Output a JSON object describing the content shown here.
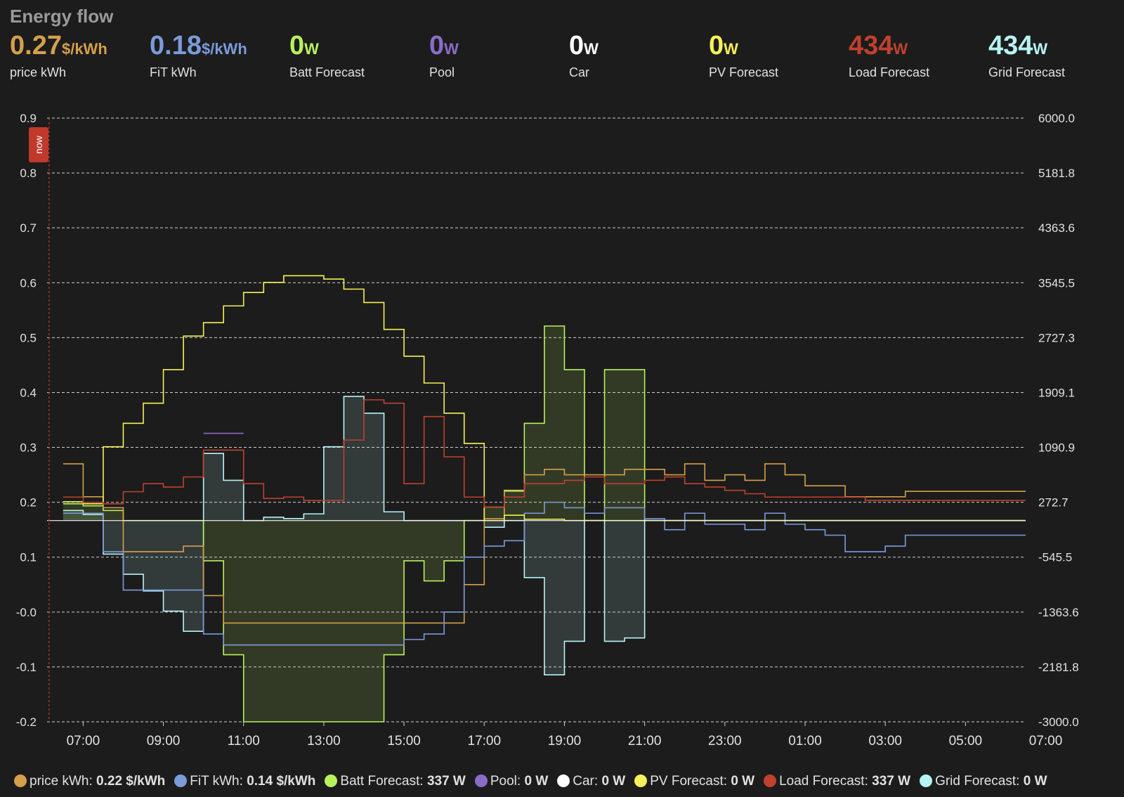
{
  "header": {
    "title": "Energy flow"
  },
  "stats": [
    {
      "value": "0.27",
      "unit": "$/kWh",
      "label": "price kWh",
      "color": "#d4a04a"
    },
    {
      "value": "0.18",
      "unit": "$/kWh",
      "label": "FiT kWh",
      "color": "#7b9bd9"
    },
    {
      "value": "0",
      "unit": "W",
      "label": "Batt Forecast",
      "color": "#b7f25c"
    },
    {
      "value": "0",
      "unit": "W",
      "label": "Pool",
      "color": "#8a6cc8"
    },
    {
      "value": "0",
      "unit": "W",
      "label": "Car",
      "color": "#ffffff"
    },
    {
      "value": "0",
      "unit": "W",
      "label": "PV Forecast",
      "color": "#f5f05a"
    },
    {
      "value": "434",
      "unit": "W",
      "label": "Load Forecast",
      "color": "#c0412e"
    },
    {
      "value": "434",
      "unit": "W",
      "label": "Grid Forecast",
      "color": "#b8f2f4"
    }
  ],
  "now_label": "now",
  "legend": [
    {
      "name": "price kWh",
      "value": "0.22 $/kWh",
      "color": "#d4a04a"
    },
    {
      "name": "FiT kWh",
      "value": "0.14 $/kWh",
      "color": "#7b9bd9"
    },
    {
      "name": "Batt Forecast",
      "value": "337 W",
      "color": "#b7f25c"
    },
    {
      "name": "Pool",
      "value": "0 W",
      "color": "#8a6cc8"
    },
    {
      "name": "Car",
      "value": "0 W",
      "color": "#ffffff"
    },
    {
      "name": "PV Forecast",
      "value": "0 W",
      "color": "#f5f05a"
    },
    {
      "name": "Load Forecast",
      "value": "337 W",
      "color": "#c0412e"
    },
    {
      "name": "Grid Forecast",
      "value": "0 W",
      "color": "#b8f2f4"
    }
  ],
  "chart_data": {
    "type": "line",
    "step": true,
    "grid": true,
    "x_ticks": [
      "07:00",
      "09:00",
      "11:00",
      "13:00",
      "15:00",
      "17:00",
      "19:00",
      "21:00",
      "23:00",
      "01:00",
      "03:00",
      "05:00",
      "07:00"
    ],
    "x_range_hours": [
      6.1,
      30.5
    ],
    "y_left": {
      "range": [
        -0.2,
        0.9
      ],
      "ticks": [
        "0.9",
        "0.8",
        "0.7",
        "0.6",
        "0.5",
        "0.4",
        "0.3",
        "0.2",
        "0.1",
        "-0.0",
        "-0.1",
        "-0.2"
      ]
    },
    "y_right": {
      "range": [
        -3000,
        6000
      ],
      "ticks": [
        "6000.0",
        "5181.8",
        "4363.6",
        "3545.5",
        "2727.3",
        "1909.1",
        "1090.9",
        "272.7",
        "-545.5",
        "-1363.6",
        "-2181.8",
        "-3000.0"
      ]
    },
    "now_hour": 6.15,
    "series": [
      {
        "name": "price kWh",
        "axis": "left",
        "color": "#d4a04a",
        "fill": false,
        "x": [
          6.5,
          7.0,
          7.5,
          8.0,
          8.5,
          9.0,
          9.5,
          10.0,
          10.5,
          11.0,
          11.5,
          12.0,
          12.5,
          13.0,
          13.5,
          14.0,
          14.5,
          15.0,
          15.5,
          16.0,
          16.5,
          17.0,
          17.5,
          18.0,
          18.5,
          19.0,
          19.5,
          20.0,
          20.5,
          21.0,
          21.5,
          22.0,
          22.5,
          23.0,
          23.5,
          24.0,
          24.5,
          25.0,
          25.5,
          26.0,
          26.5,
          27.0,
          27.5,
          28.0,
          28.5,
          29.0,
          29.5,
          30.0,
          30.5
        ],
        "y": [
          0.27,
          0.21,
          0.19,
          0.11,
          0.11,
          0.11,
          0.12,
          0.03,
          -0.02,
          -0.02,
          -0.02,
          -0.02,
          -0.02,
          -0.02,
          -0.02,
          -0.02,
          -0.02,
          -0.02,
          -0.02,
          -0.02,
          0.05,
          0.17,
          0.22,
          0.25,
          0.26,
          0.25,
          0.25,
          0.25,
          0.26,
          0.26,
          0.25,
          0.27,
          0.24,
          0.25,
          0.24,
          0.27,
          0.25,
          0.23,
          0.23,
          0.21,
          0.21,
          0.21,
          0.22,
          0.22,
          0.22,
          0.22,
          0.22,
          0.22,
          0.22
        ]
      },
      {
        "name": "FiT kWh",
        "axis": "left",
        "color": "#7b9bd9",
        "fill": false,
        "x": [
          6.5,
          7.0,
          7.5,
          8.0,
          8.5,
          9.0,
          9.5,
          10.0,
          10.5,
          11.0,
          11.5,
          12.0,
          12.5,
          13.0,
          13.5,
          14.0,
          14.5,
          15.0,
          15.5,
          16.0,
          16.5,
          17.0,
          17.5,
          18.0,
          18.5,
          19.0,
          19.5,
          20.0,
          20.5,
          21.0,
          21.5,
          22.0,
          22.5,
          23.0,
          23.5,
          24.0,
          24.5,
          25.0,
          25.5,
          26.0,
          26.5,
          27.0,
          27.5,
          28.0,
          28.5,
          29.0,
          29.5,
          30.0,
          30.5
        ],
        "y": [
          0.18,
          0.18,
          0.11,
          0.04,
          0.04,
          0.04,
          0.04,
          -0.04,
          -0.06,
          -0.06,
          -0.06,
          -0.06,
          -0.06,
          -0.06,
          -0.06,
          -0.06,
          -0.06,
          -0.05,
          -0.04,
          0.0,
          0.1,
          0.12,
          0.13,
          0.18,
          0.2,
          0.19,
          0.18,
          0.19,
          0.19,
          0.17,
          0.15,
          0.18,
          0.16,
          0.16,
          0.15,
          0.18,
          0.16,
          0.15,
          0.14,
          0.11,
          0.11,
          0.12,
          0.14,
          0.14,
          0.14,
          0.14,
          0.14,
          0.14,
          0.14
        ]
      },
      {
        "name": "PV Forecast",
        "axis": "right",
        "color": "#f5f05a",
        "fill": false,
        "x": [
          6.5,
          7.0,
          7.5,
          8.0,
          8.5,
          9.0,
          9.5,
          10.0,
          10.5,
          11.0,
          11.5,
          12.0,
          12.5,
          13.0,
          13.5,
          14.0,
          14.5,
          15.0,
          15.5,
          16.0,
          16.5,
          17.0,
          17.5,
          18.0,
          18.5,
          19.0,
          19.5,
          20.0,
          20.5,
          21.0,
          21.5,
          22.0,
          30.5
        ],
        "y": [
          280,
          250,
          1100,
          1450,
          1750,
          2250,
          2750,
          2950,
          3200,
          3400,
          3550,
          3650,
          3650,
          3600,
          3450,
          3250,
          2850,
          2450,
          2050,
          1600,
          1150,
          0,
          80,
          20,
          20,
          0,
          0,
          0,
          0,
          0,
          0,
          0,
          0
        ]
      },
      {
        "name": "Load Forecast",
        "axis": "right",
        "color": "#c0412e",
        "fill": false,
        "x": [
          6.5,
          7.0,
          7.5,
          8.0,
          8.5,
          9.0,
          9.5,
          10.0,
          10.5,
          11.0,
          11.5,
          12.0,
          12.5,
          13.0,
          13.5,
          14.0,
          14.5,
          15.0,
          15.5,
          16.0,
          16.5,
          17.0,
          17.5,
          18.0,
          18.5,
          19.0,
          19.5,
          20.0,
          20.5,
          21.0,
          21.5,
          22.0,
          22.5,
          23.0,
          23.5,
          24.0,
          24.5,
          25.0,
          25.5,
          26.0,
          26.5,
          27.0,
          27.5,
          28.0,
          28.5,
          29.0,
          29.5,
          30.0,
          30.5
        ],
        "y": [
          350,
          270,
          250,
          430,
          550,
          500,
          650,
          1050,
          1050,
          550,
          330,
          350,
          300,
          300,
          1200,
          1800,
          1750,
          550,
          1550,
          950,
          350,
          200,
          350,
          550,
          550,
          600,
          650,
          550,
          550,
          600,
          650,
          550,
          500,
          450,
          400,
          350,
          350,
          350,
          350,
          350,
          300,
          300,
          300,
          300,
          300,
          300,
          300,
          300,
          300
        ]
      },
      {
        "name": "Grid Forecast",
        "axis": "right",
        "color": "#b8f2f4",
        "fill": true,
        "x": [
          6.5,
          7.0,
          7.5,
          8.0,
          8.5,
          9.0,
          9.5,
          10.0,
          10.5,
          11.0,
          11.5,
          12.0,
          12.5,
          13.0,
          13.5,
          14.0,
          14.5,
          15.0,
          15.5,
          16.0,
          16.5,
          17.0,
          17.5,
          18.0,
          18.5,
          19.0,
          19.5,
          20.0,
          20.5,
          21.0,
          21.5,
          22.0,
          22.5,
          23.0,
          30.5
        ],
        "y": [
          150,
          90,
          -500,
          -800,
          -1050,
          -1350,
          -1650,
          1000,
          600,
          0,
          50,
          30,
          100,
          1100,
          1850,
          1600,
          130,
          0,
          0,
          0,
          0,
          -100,
          0,
          -850,
          -2300,
          -1800,
          0,
          -1800,
          -1750,
          0,
          0,
          0,
          0,
          0,
          0
        ]
      },
      {
        "name": "Batt Forecast",
        "axis": "right",
        "color": "#b7f25c",
        "fill": true,
        "x": [
          6.5,
          7.0,
          7.5,
          8.0,
          8.5,
          9.0,
          9.5,
          10.0,
          10.5,
          11.0,
          11.5,
          12.0,
          12.5,
          13.0,
          13.5,
          14.0,
          14.5,
          15.0,
          15.5,
          16.0,
          16.5,
          17.0,
          17.5,
          18.0,
          18.5,
          19.0,
          19.5,
          20.0,
          20.5,
          21.0,
          21.5,
          22.0,
          30.5
        ],
        "y": [
          250,
          220,
          150,
          0,
          0,
          0,
          0,
          -600,
          -2000,
          -3000,
          -3000,
          -3000,
          -3000,
          -3000,
          -3000,
          -3000,
          -2000,
          -600,
          -900,
          -600,
          0,
          200,
          450,
          1450,
          2900,
          2250,
          0,
          2250,
          2250,
          0,
          0,
          0,
          0
        ]
      },
      {
        "name": "Pool",
        "axis": "right",
        "color": "#8a6cc8",
        "fill": false,
        "x": [
          10.0,
          10.5,
          11.0
        ],
        "y": [
          1300,
          1300,
          0
        ]
      }
    ]
  }
}
